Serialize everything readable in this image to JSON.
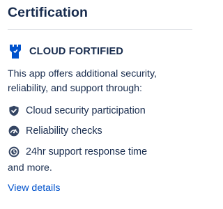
{
  "panel": {
    "title": "Certification",
    "badge": {
      "icon": "fortified-tower-icon",
      "label": "CLOUD FORTIFIED",
      "icon_color": "#0052cc"
    },
    "description": "This app offers additional security, reliability, and support through:",
    "features": [
      {
        "icon": "shield-check-icon",
        "label": "Cloud security participation"
      },
      {
        "icon": "reliability-gauge-icon",
        "label": "Reliability checks"
      },
      {
        "icon": "support-clock-icon",
        "label": "24hr support response time"
      }
    ],
    "more_text": "and more.",
    "view_details_label": "View details",
    "colors": {
      "text": "#172b4d",
      "link": "#0052cc",
      "divider": "#dfe1e6",
      "icon": "#344563"
    }
  }
}
